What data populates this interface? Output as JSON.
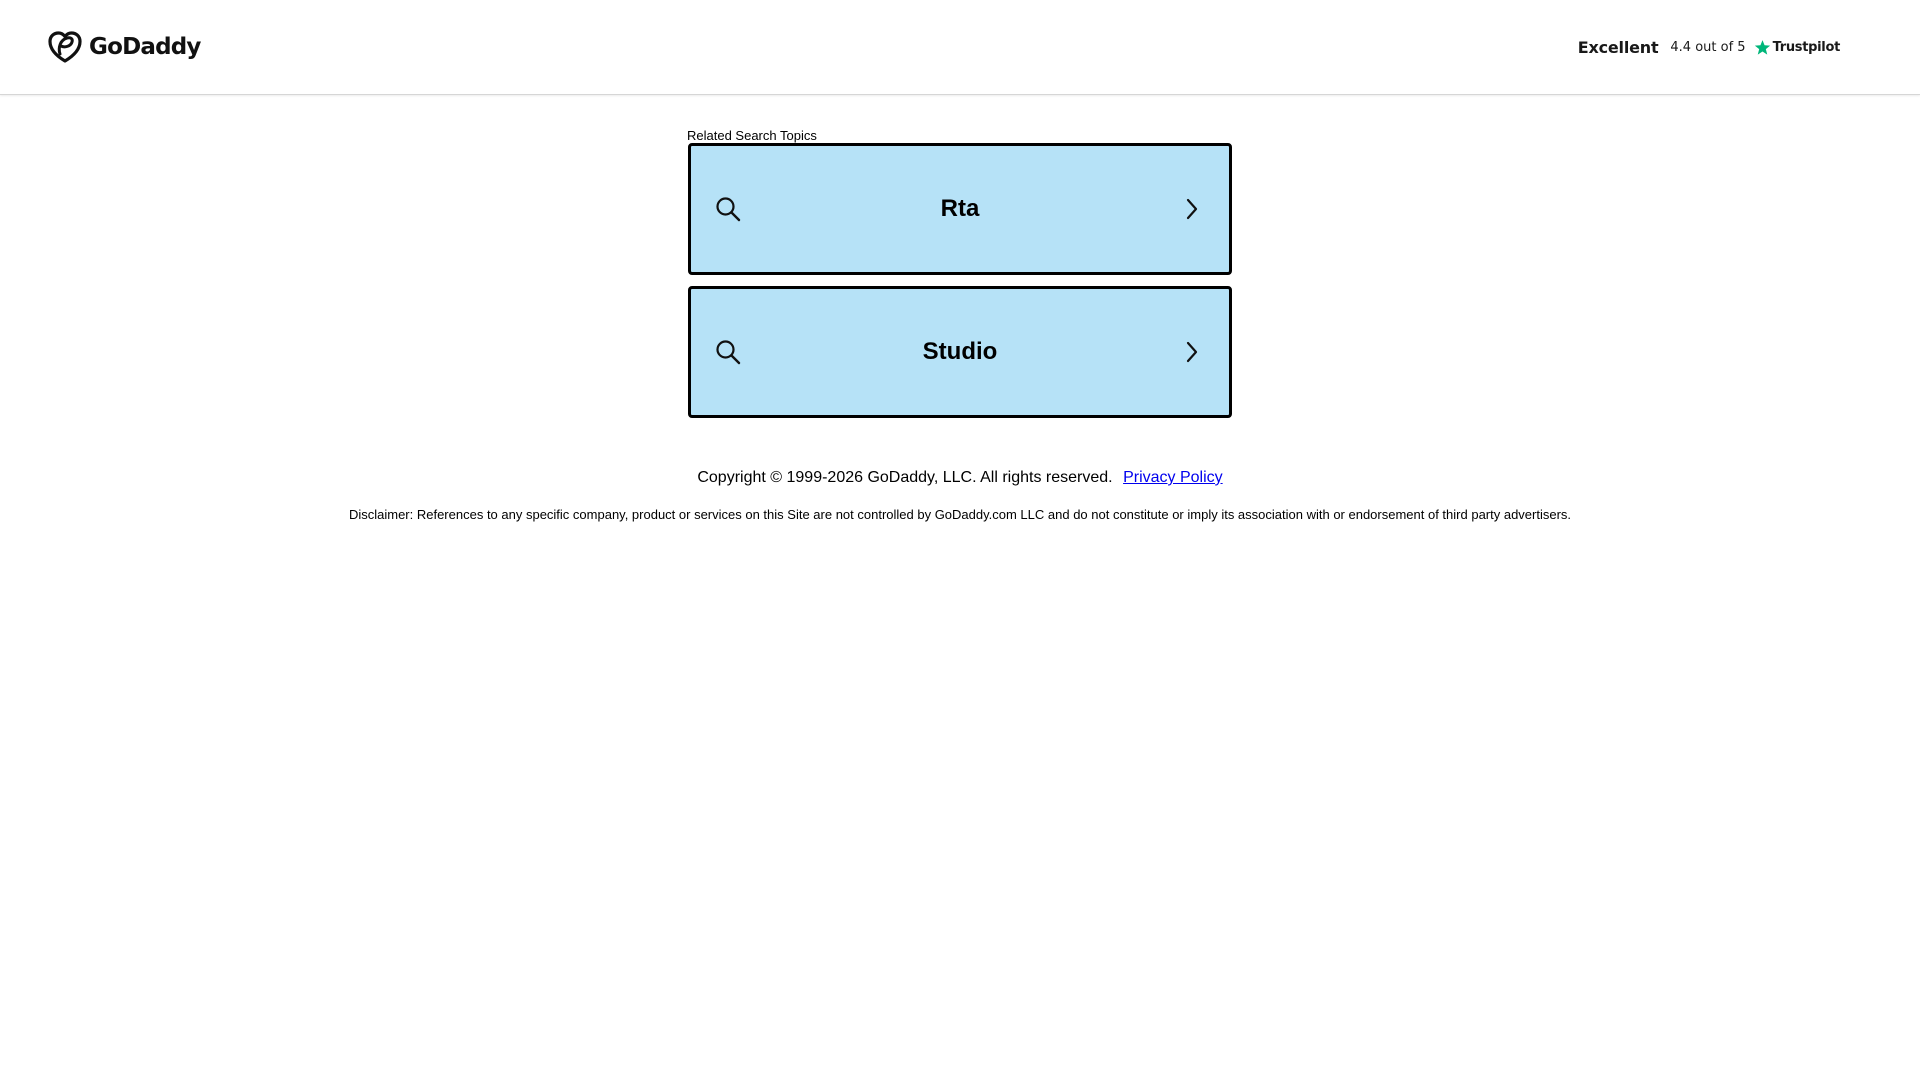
{
  "header": {
    "logo_text": "GoDaddy",
    "trustpilot": {
      "rating_word": "Excellent",
      "rating_text": "4.4 out of 5",
      "brand": "Trustpilot",
      "star_color": "#00b67a"
    }
  },
  "main": {
    "related_label": "Related Search Topics",
    "topics": [
      {
        "label": "Rta"
      },
      {
        "label": "Studio"
      }
    ],
    "topic_background": "#b6e2f7"
  },
  "footer": {
    "copyright": "Copyright © 1999-2026 GoDaddy, LLC. All rights reserved.",
    "privacy_link": "Privacy Policy",
    "disclaimer": "Disclaimer: References to any specific company, product or services on this Site are not controlled by GoDaddy.com LLC and do not constitute or imply its association with or endorsement of third party advertisers."
  },
  "icons": {
    "logo": "godaddy-heart-icon",
    "search": "search-icon",
    "chevron": "chevron-right-icon",
    "star": "star-icon"
  }
}
